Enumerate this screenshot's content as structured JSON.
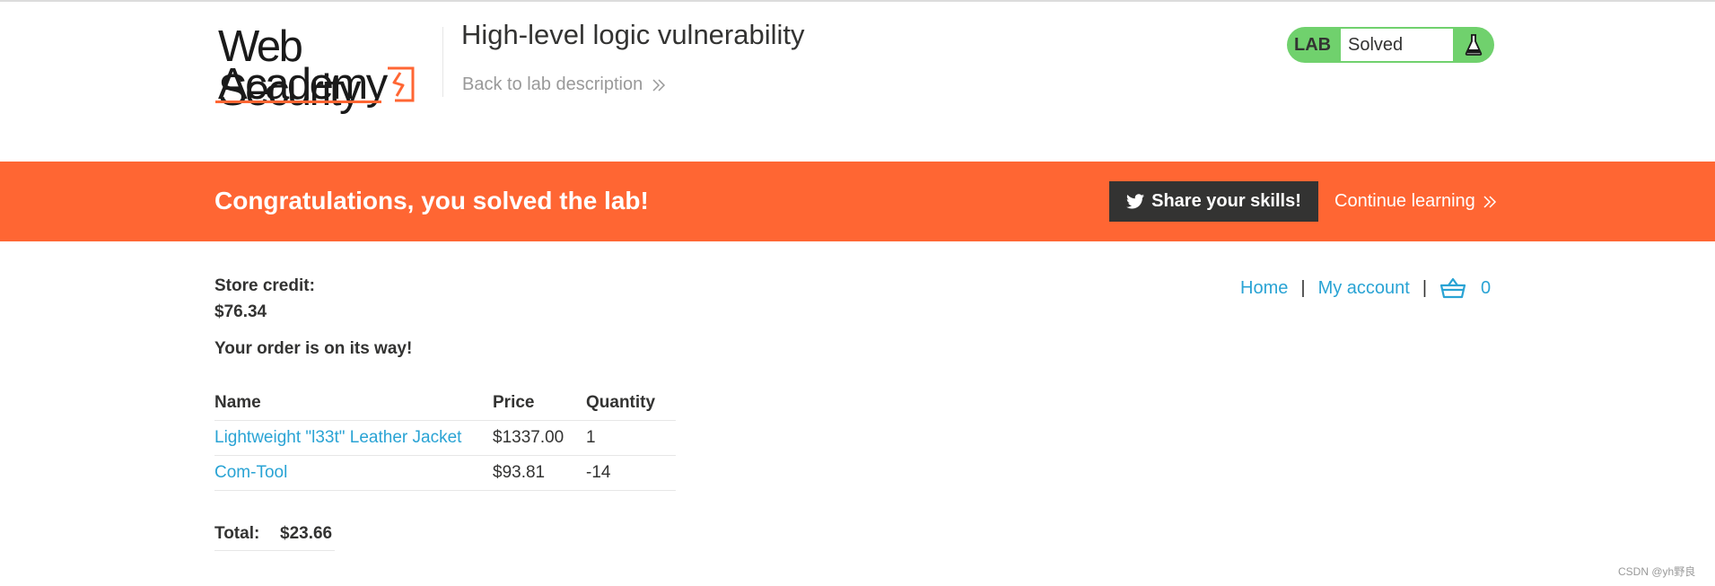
{
  "header": {
    "logo_line1": "Web Security",
    "logo_line2": "Academy",
    "lab_title": "High-level logic vulnerability",
    "back_link": "Back to lab description"
  },
  "lab_status": {
    "badge": "LAB",
    "status": "Solved"
  },
  "banner": {
    "message": "Congratulations, you solved the lab!",
    "share_button": "Share your skills!",
    "continue_link": "Continue learning"
  },
  "nav": {
    "home": "Home",
    "separator": "|",
    "my_account": "My account",
    "cart_count": "0"
  },
  "store": {
    "credit_label": "Store credit:",
    "credit_value": "$76.34",
    "order_message": "Your order is on its way!"
  },
  "order_table": {
    "headers": {
      "name": "Name",
      "price": "Price",
      "quantity": "Quantity"
    },
    "rows": [
      {
        "name": "Lightweight \"l33t\" Leather Jacket",
        "price": "$1337.00",
        "quantity": "1"
      },
      {
        "name": "Com-Tool",
        "price": "$93.81",
        "quantity": "-14"
      }
    ]
  },
  "total": {
    "label": "Total:",
    "value": "$23.66"
  },
  "watermark": "CSDN @yh野良",
  "colors": {
    "accent_orange": "#ff6633",
    "link_blue": "#29a3d4",
    "status_green": "#70d16d",
    "dark": "#333332"
  },
  "icons": {
    "logo_mark": "lightning-bracket-icon",
    "lab_flask": "flask-icon",
    "share": "twitter-icon",
    "cart": "basket-icon",
    "chevrons": "double-chevron-right-icon"
  }
}
